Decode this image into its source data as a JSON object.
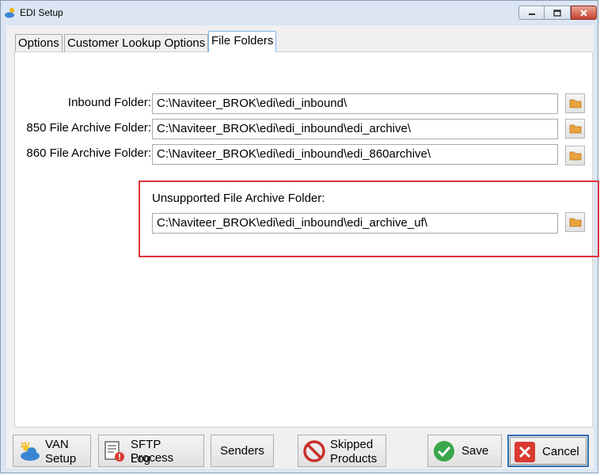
{
  "window": {
    "title": "EDI Setup"
  },
  "tabs": [
    {
      "label": "Options",
      "active": false
    },
    {
      "label": "Customer Lookup Options",
      "active": false
    },
    {
      "label": "File Folders",
      "active": true
    }
  ],
  "folders": {
    "inbound": {
      "label": "Inbound Folder:",
      "value": "C:\\Naviteer_BROK\\edi\\edi_inbound\\"
    },
    "archive850": {
      "label": "850 File Archive Folder:",
      "value": "C:\\Naviteer_BROK\\edi\\edi_inbound\\edi_archive\\"
    },
    "archive860": {
      "label": "860 File Archive Folder:",
      "value": "C:\\Naviteer_BROK\\edi\\edi_inbound\\edi_860archive\\"
    },
    "unsupported": {
      "label": "Unsupported File Archive Folder:",
      "value": "C:\\Naviteer_BROK\\edi\\edi_inbound\\edi_archive_uf\\"
    }
  },
  "buttons": {
    "van": {
      "line1": "VAN",
      "line2": "Setup"
    },
    "sftp": {
      "line1": "SFTP Process",
      "line2": "Log"
    },
    "senders": {
      "label": "Senders"
    },
    "skipped": {
      "line1": "Skipped",
      "line2": "Products"
    },
    "save": {
      "label": "Save"
    },
    "cancel": {
      "label": "Cancel"
    }
  },
  "colors": {
    "highlight": "#e0333a",
    "save_icon": "#3aa64a",
    "cancel_icon": "#d83a2f",
    "skipped_icon": "#c9302c"
  }
}
